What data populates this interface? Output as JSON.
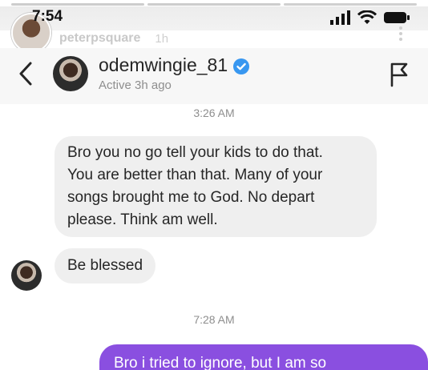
{
  "story": {
    "time": "7:54",
    "username": "peterpsquare",
    "age": "1h"
  },
  "header": {
    "name": "odemwingie_81",
    "status": "Active 3h ago"
  },
  "chat": {
    "timestamp_1": "3:26 AM",
    "message_1_lines": [
      "Bro you no go tell your kids to do that.",
      "You are better than that. Many of your",
      "songs brought me to God. No depart",
      "please. Think am well."
    ],
    "message_2": "Be blessed",
    "timestamp_2": "7:28 AM",
    "outgoing_1": "Bro i tried to ignore, but I am so"
  },
  "colors": {
    "accent": "#8a4fe0",
    "verified": "#3897f0",
    "bubble_in": "#efefef"
  },
  "icons": [
    "back-icon",
    "verified-icon",
    "flag-icon",
    "signal-icon",
    "wifi-icon",
    "battery-icon",
    "more-icon"
  ]
}
